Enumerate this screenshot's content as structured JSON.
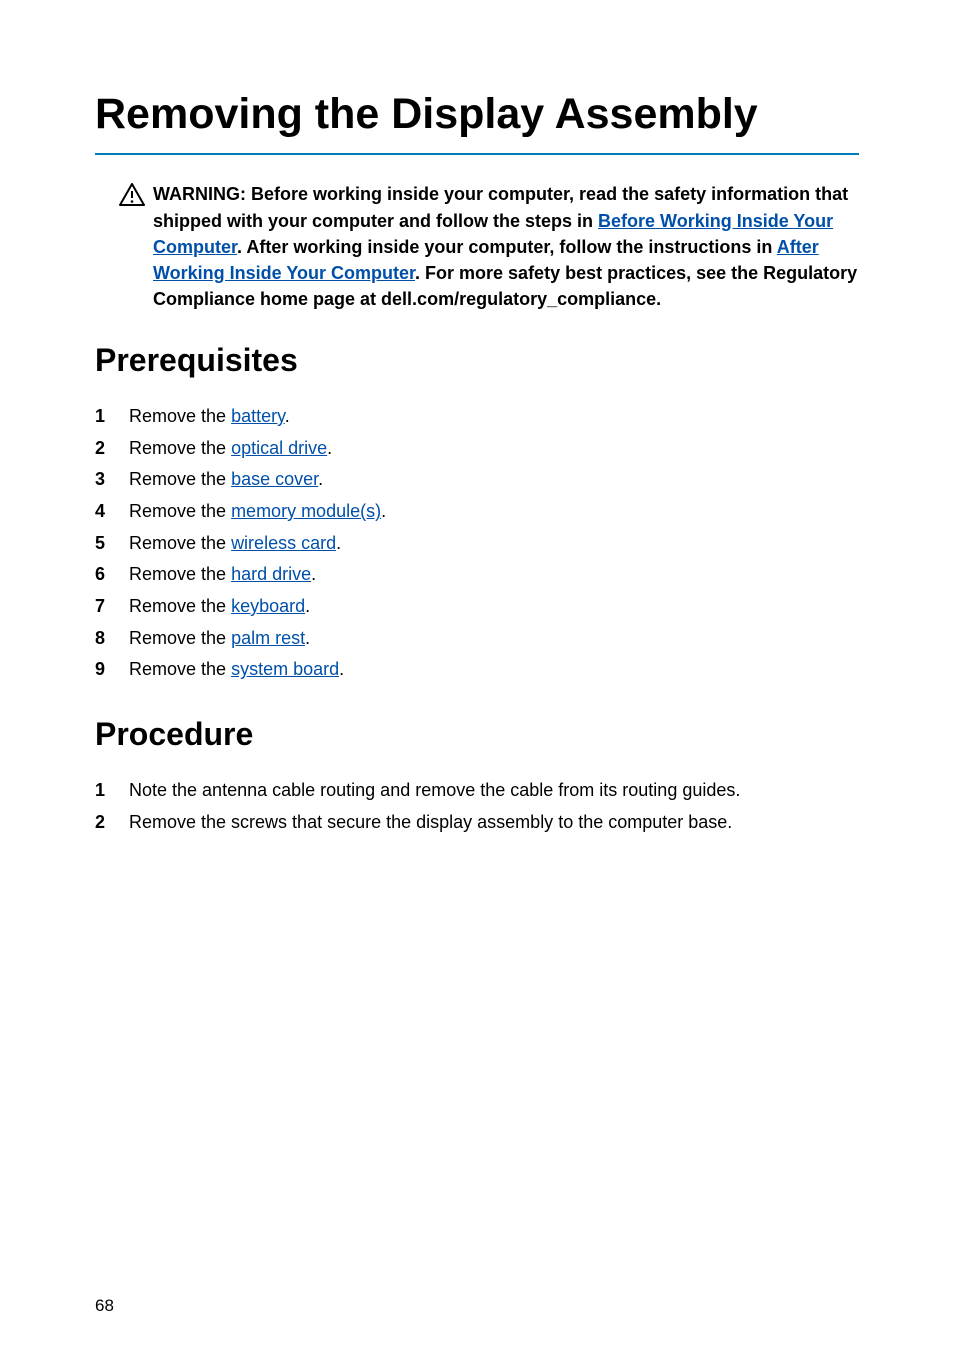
{
  "page_number": "68",
  "title": "Removing the Display Assembly",
  "warning": {
    "parts": [
      {
        "t": "text",
        "v": "WARNING: Before working inside your computer, read the safety information that shipped with your computer and follow the steps in "
      },
      {
        "t": "link",
        "v": "Before Working Inside Your Computer"
      },
      {
        "t": "text",
        "v": ". After working inside your computer, follow the instructions in "
      },
      {
        "t": "link",
        "v": "After Working Inside Your Computer"
      },
      {
        "t": "text",
        "v": ". For more safety best practices, see the Regulatory Compliance home page at dell.com/regulatory_compliance."
      }
    ]
  },
  "sections": {
    "prerequisites": {
      "heading": "Prerequisites",
      "items": [
        {
          "num": "1",
          "prefix": "Remove the ",
          "link": "battery",
          "suffix": "."
        },
        {
          "num": "2",
          "prefix": "Remove the ",
          "link": "optical drive",
          "suffix": "."
        },
        {
          "num": "3",
          "prefix": "Remove the ",
          "link": "base cover",
          "suffix": "."
        },
        {
          "num": "4",
          "prefix": "Remove the ",
          "link": "memory module(s)",
          "suffix": "."
        },
        {
          "num": "5",
          "prefix": "Remove the ",
          "link": "wireless card",
          "suffix": "."
        },
        {
          "num": "6",
          "prefix": "Remove the ",
          "link": "hard drive",
          "suffix": "."
        },
        {
          "num": "7",
          "prefix": "Remove the ",
          "link": "keyboard",
          "suffix": "."
        },
        {
          "num": "8",
          "prefix": "Remove the ",
          "link": "palm rest",
          "suffix": "."
        },
        {
          "num": "9",
          "prefix": "Remove the ",
          "link": "system board",
          "suffix": "."
        }
      ]
    },
    "procedure": {
      "heading": "Procedure",
      "items": [
        {
          "num": "1",
          "text": "Note the antenna cable routing and remove the cable from its routing guides."
        },
        {
          "num": "2",
          "text": "Remove the screws that secure the display assembly to the computer base."
        }
      ]
    }
  }
}
